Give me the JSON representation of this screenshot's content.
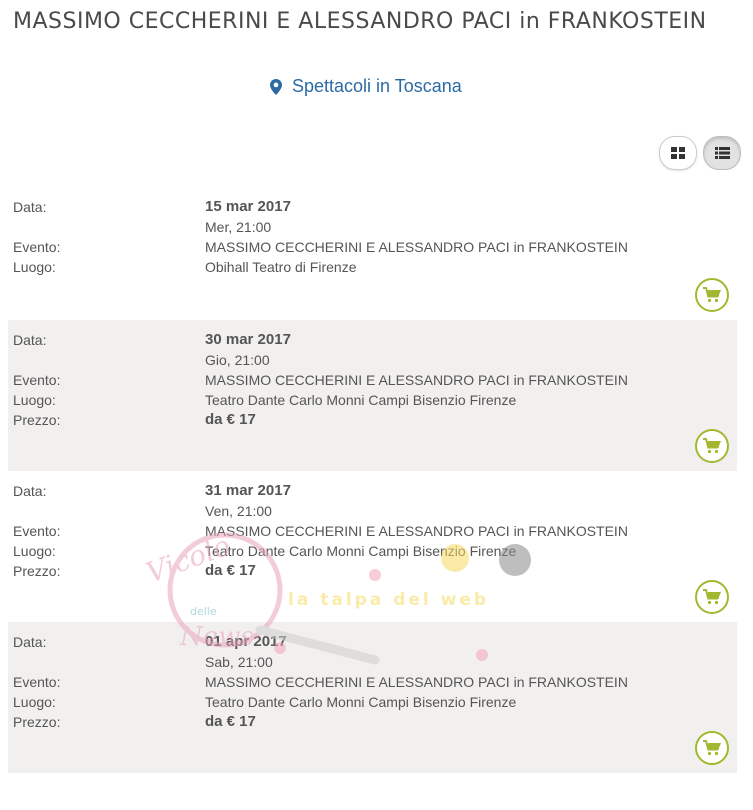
{
  "page": {
    "title": "MASSIMO CECCHERINI E ALESSANDRO PACI in FRANKOSTEIN",
    "location_link": "Spettacoli in Toscana",
    "location_icon": "map-marker-icon",
    "view_toggle": {
      "grid_icon": "grid-view-icon",
      "list_icon": "list-view-icon",
      "active": "list"
    }
  },
  "labels": {
    "date": "Data:",
    "event": "Evento:",
    "venue": "Luogo:",
    "price": "Prezzo:"
  },
  "colors": {
    "link": "#2b6aa3",
    "cart": "#a3b830",
    "shaded_row": "#f2f0ee"
  },
  "events": [
    {
      "date": "15 mar 2017",
      "time": "Mer, 21:00",
      "event": "MASSIMO CECCHERINI E ALESSANDRO PACI in FRANKOSTEIN",
      "venue": "Obihall Teatro di Firenze",
      "price": null
    },
    {
      "date": "30 mar 2017",
      "time": "Gio, 21:00",
      "event": "MASSIMO CECCHERINI E ALESSANDRO PACI in FRANKOSTEIN",
      "venue": "Teatro Dante Carlo Monni Campi Bisenzio Firenze",
      "price": "da € 17"
    },
    {
      "date": "31 mar 2017",
      "time": "Ven, 21:00",
      "event": "MASSIMO CECCHERINI E ALESSANDRO PACI in FRANKOSTEIN",
      "venue": "Teatro Dante Carlo Monni Campi Bisenzio Firenze",
      "price": "da € 17"
    },
    {
      "date": "01 apr 2017",
      "time": "Sab, 21:00",
      "event": "MASSIMO CECCHERINI E ALESSANDRO PACI in FRANKOSTEIN",
      "venue": "Teatro Dante Carlo Monni Campi Bisenzio Firenze",
      "price": "da € 17"
    }
  ],
  "watermark": {
    "logo_text": "Vicolo delle News",
    "tagline": "la talpa del web"
  }
}
